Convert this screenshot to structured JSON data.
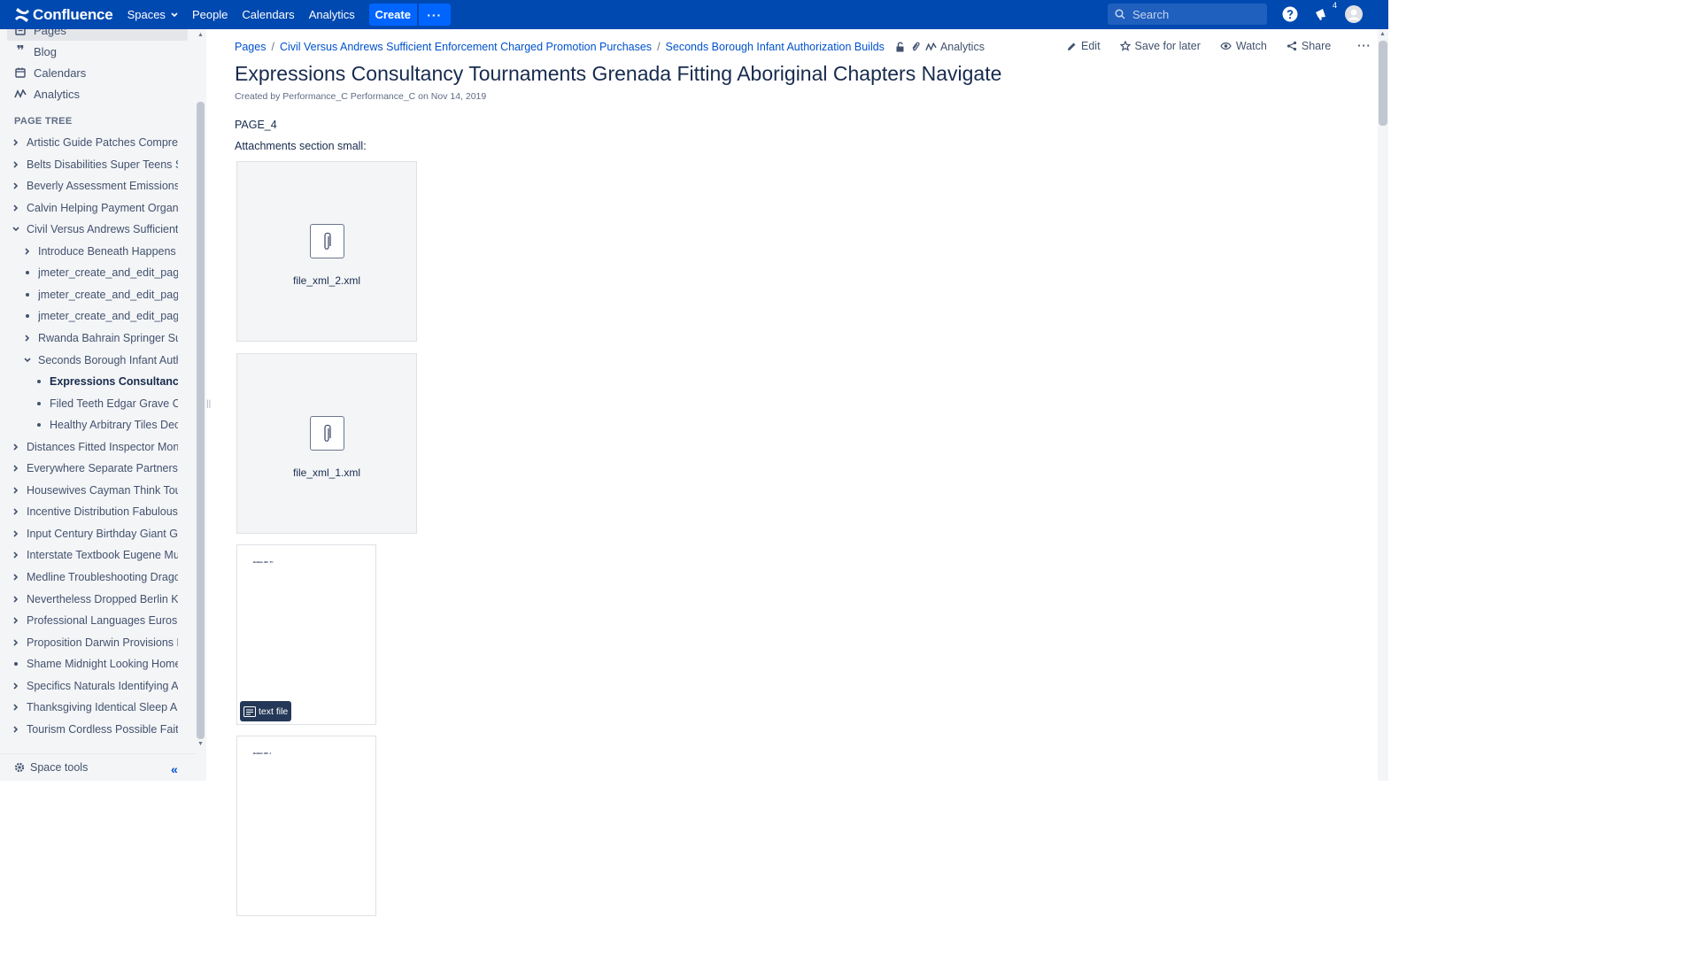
{
  "topbar": {
    "logo_text": "Confluence",
    "nav": [
      "Spaces",
      "People",
      "Calendars",
      "Analytics"
    ],
    "create_label": "Create",
    "search_placeholder": "Search",
    "notification_count": "4",
    "brand_color": "#0049b0"
  },
  "sidebar": {
    "nav": [
      {
        "label": "Pages",
        "icon": "pages-icon"
      },
      {
        "label": "Blog",
        "icon": "quote-icon"
      },
      {
        "label": "Calendars",
        "icon": "calendar-icon"
      },
      {
        "label": "Analytics",
        "icon": "analytics-icon"
      }
    ],
    "page_tree_heading": "PAGE TREE",
    "tree": [
      {
        "label": "Artistic Guide Patches Compresse",
        "level": 0,
        "state": "collapsed"
      },
      {
        "label": "Belts Disabilities Super Teens Sol",
        "level": 0,
        "state": "collapsed"
      },
      {
        "label": "Beverly Assessment Emissions Ar",
        "level": 0,
        "state": "collapsed"
      },
      {
        "label": "Calvin Helping Payment Organize",
        "level": 0,
        "state": "collapsed"
      },
      {
        "label": "Civil Versus Andrews Sufficient Er",
        "level": 0,
        "state": "expanded"
      },
      {
        "label": "Introduce Beneath Happens Ne",
        "level": 1,
        "state": "collapsed"
      },
      {
        "label": "jmeter_create_and_edit_page:c",
        "level": 1,
        "state": "leaf"
      },
      {
        "label": "jmeter_create_and_edit_page:c",
        "level": 1,
        "state": "leaf"
      },
      {
        "label": "jmeter_create_and_edit_page:c",
        "level": 1,
        "state": "leaf"
      },
      {
        "label": "Rwanda Bahrain Springer Supp",
        "level": 1,
        "state": "collapsed"
      },
      {
        "label": "Seconds Borough Infant Authori",
        "level": 1,
        "state": "expanded"
      },
      {
        "label": "Expressions Consultancy T",
        "level": 2,
        "state": "leaf",
        "current": true
      },
      {
        "label": "Filed Teeth Edgar Grave Orga",
        "level": 2,
        "state": "leaf"
      },
      {
        "label": "Healthy Arbitrary Tiles Decline",
        "level": 2,
        "state": "leaf"
      },
      {
        "label": "Distances Fitted Inspector Monroe",
        "level": 0,
        "state": "collapsed"
      },
      {
        "label": "Everywhere Separate Partnership",
        "level": 0,
        "state": "collapsed"
      },
      {
        "label": "Housewives Cayman Think Touris",
        "level": 0,
        "state": "collapsed"
      },
      {
        "label": "Incentive Distribution Fabulous Fi",
        "level": 0,
        "state": "collapsed"
      },
      {
        "label": "Input Century Birthday Giant Glas",
        "level": 0,
        "state": "collapsed"
      },
      {
        "label": "Interstate Textbook Eugene Multir",
        "level": 0,
        "state": "collapsed"
      },
      {
        "label": "Medline Troubleshooting Dragon I",
        "level": 0,
        "state": "collapsed"
      },
      {
        "label": "Nevertheless Dropped Berlin Killir",
        "level": 0,
        "state": "collapsed"
      },
      {
        "label": "Professional Languages Euros Op",
        "level": 0,
        "state": "collapsed"
      },
      {
        "label": "Proposition Darwin Provisions Ber",
        "level": 0,
        "state": "collapsed"
      },
      {
        "label": "Shame Midnight Looking Home",
        "level": 0,
        "state": "leaf"
      },
      {
        "label": "Specifics Naturals Identifying Anin",
        "level": 0,
        "state": "collapsed"
      },
      {
        "label": "Thanksgiving Identical Sleep Ange",
        "level": 0,
        "state": "collapsed"
      },
      {
        "label": "Tourism Cordless Possible Faith C",
        "level": 0,
        "state": "collapsed"
      }
    ],
    "space_tools": "Space tools"
  },
  "page": {
    "breadcrumbs": [
      "Pages",
      "Civil Versus Andrews Sufficient Enforcement Charged Promotion Purchases",
      "Seconds Borough Infant Authorization Builds"
    ],
    "analytics_label": "Analytics",
    "actions": {
      "edit": "Edit",
      "save_for_later": "Save for later",
      "watch": "Watch",
      "share": "Share"
    },
    "title": "Expressions Consultancy Tournaments Grenada Fitting Aboriginal Chapters Navigate",
    "byline": "Created by Performance_C Performance_C on Nov 14, 2019",
    "body_line1": "PAGE_4",
    "body_line2": "Attachments section small:",
    "attachments": [
      {
        "type": "file",
        "name": "file_xml_2.xml"
      },
      {
        "type": "file",
        "name": "file_xml_1.xml"
      },
      {
        "type": "preview",
        "tag": "text file",
        "tiny": "Bulletin 495_TC"
      },
      {
        "type": "preview",
        "tiny": "Bulletin 495_1"
      }
    ],
    "link_color": "#0052cc"
  }
}
